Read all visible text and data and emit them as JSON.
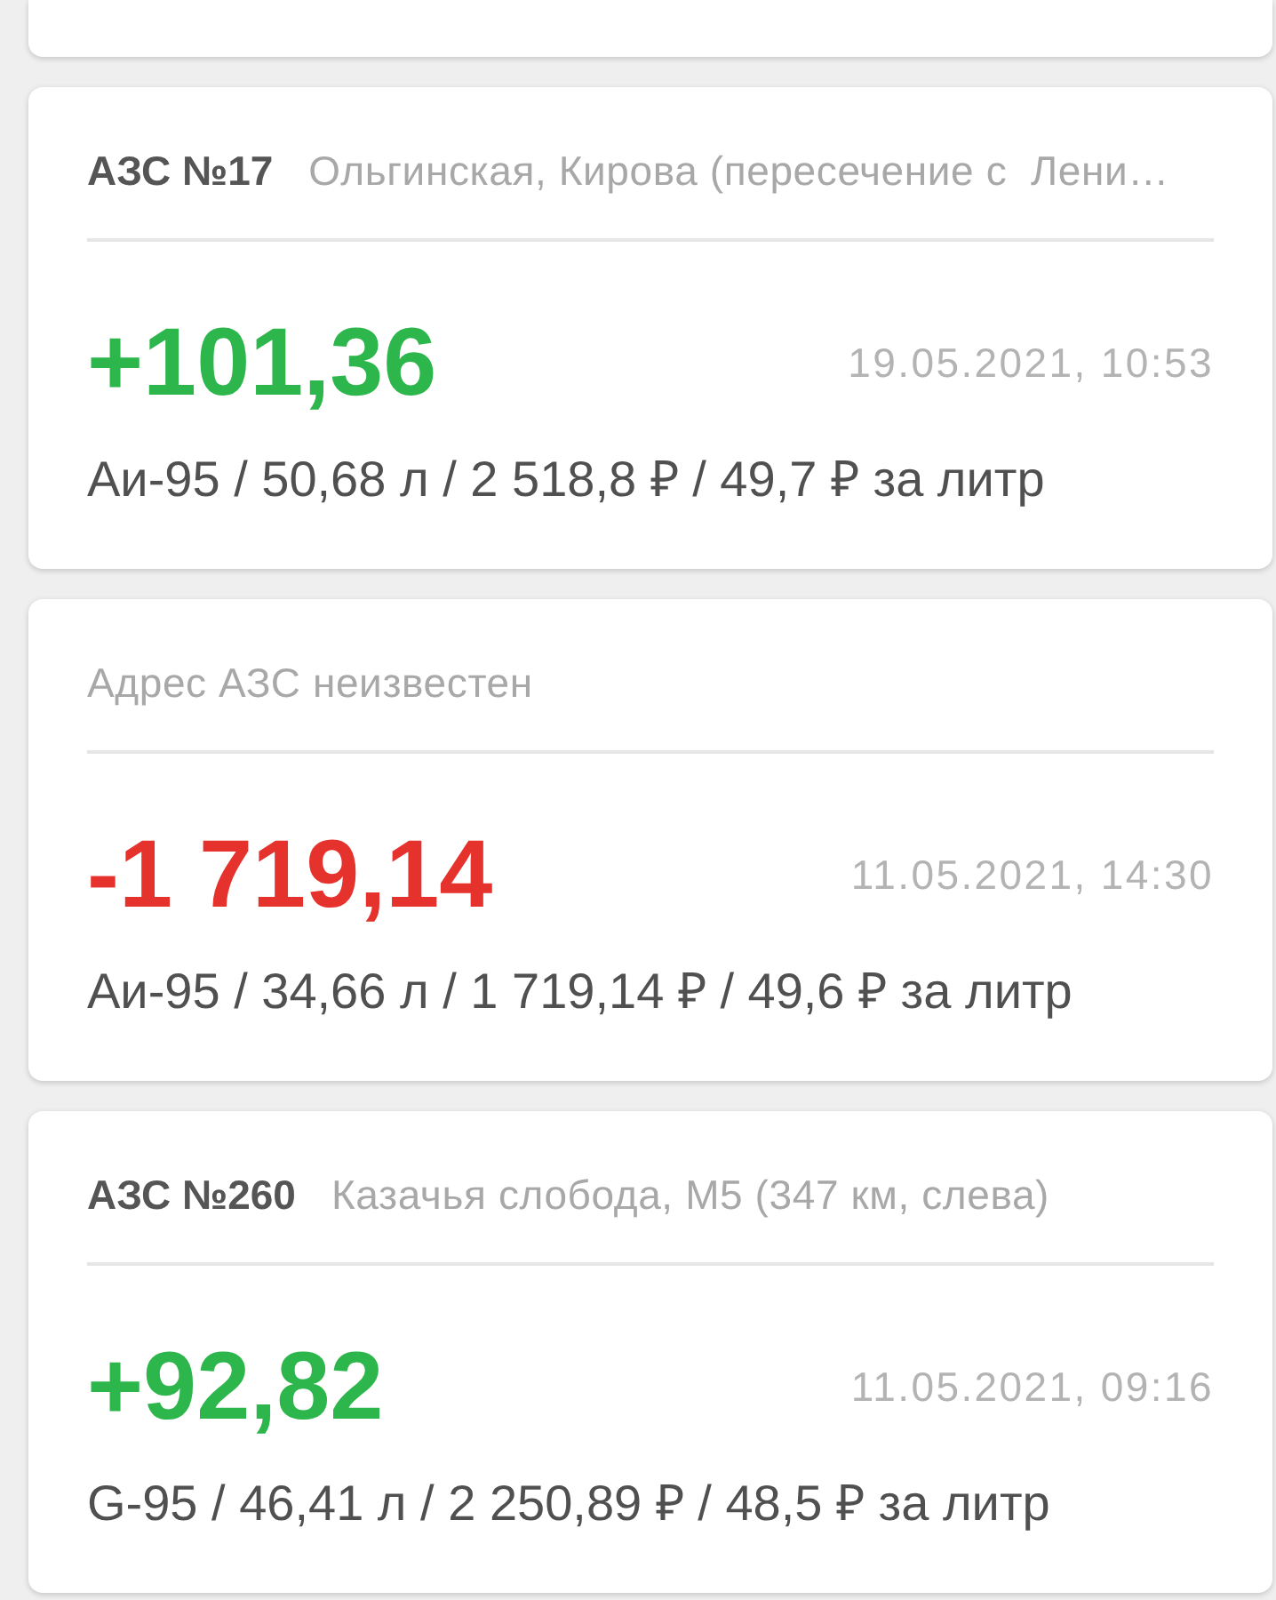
{
  "transactions": [
    {
      "station": "АЗС №17",
      "address": "Ольгинская, Кирова (пересечение с  Лени…",
      "amount": "+101,36",
      "kind": "credit",
      "datetime": "19.05.2021, 10:53",
      "details": "Аи-95 / 50,68 л / 2 518,8 ₽ / 49,7 ₽ за литр"
    },
    {
      "address": "Адрес АЗС неизвестен",
      "amount": "-1 719,14",
      "kind": "debit",
      "datetime": "11.05.2021, 14:30",
      "details": "Аи-95 / 34,66 л / 1 719,14 ₽ / 49,6 ₽ за литр"
    },
    {
      "station": "АЗС №260",
      "address": "Казачья слобода, М5 (347 км, слева)",
      "amount": "+92,82",
      "kind": "credit",
      "datetime": "11.05.2021, 09:16",
      "details": "G-95 / 46,41 л / 2 250,89 ₽ / 48,5 ₽ за литр"
    }
  ]
}
